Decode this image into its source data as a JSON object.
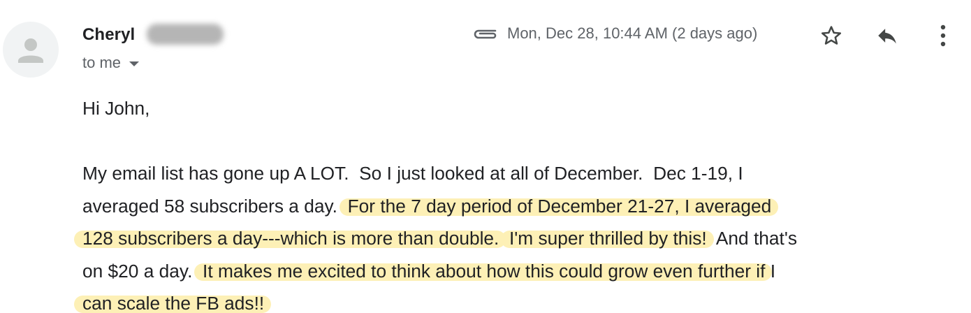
{
  "header": {
    "sender_name": "Cheryl",
    "recipient_label": "to me",
    "date": "Mon, Dec 28, 10:44 AM (2 days ago)"
  },
  "icons": {
    "avatar": "person-icon",
    "attachment": "paperclip-icon",
    "star": "star-icon",
    "reply": "reply-icon",
    "more": "more-vert-icon",
    "dropdown": "caret-down-icon"
  },
  "colors": {
    "highlight": "#fdf0b6",
    "text": "#202124",
    "secondary": "#5f6368",
    "avatar_bg": "#f1f3f4"
  },
  "body": {
    "greeting": "Hi John,",
    "line1": "My email list has gone up A LOT.  So I just looked at all of December.  Dec 1-19, I",
    "line2_plain": "averaged 58 subscribers a day.  ",
    "line2_highlight": "For the 7 day period of December 21-27, I averaged",
    "line3_highlight_a": "128 subscribers a day---which is more than double.",
    "line3_gap": "  ",
    "line3_highlight_b": "I'm super thrilled by this!",
    "line3_plain": "  And that's",
    "line4_plain": "on $20 a day.  ",
    "line4_highlight": "It makes me excited to think about how this could grow even further if",
    "line4_tail": " I",
    "line5_highlight": "can scale the FB ads!!"
  }
}
